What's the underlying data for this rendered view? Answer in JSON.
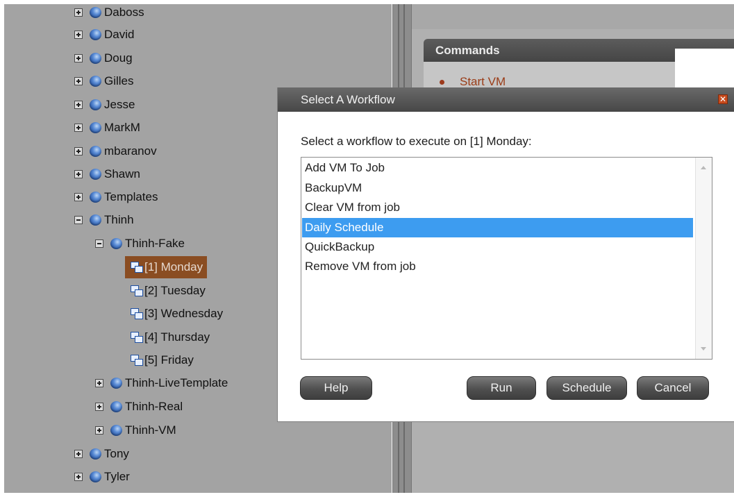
{
  "tree": {
    "nodes": [
      {
        "label": "Daboss",
        "expander": "plus"
      },
      {
        "label": "David",
        "expander": "plus"
      },
      {
        "label": "Doug",
        "expander": "plus"
      },
      {
        "label": "Gilles",
        "expander": "plus"
      },
      {
        "label": "Jesse",
        "expander": "plus"
      },
      {
        "label": "MarkM",
        "expander": "plus"
      },
      {
        "label": "mbaranov",
        "expander": "plus"
      },
      {
        "label": "Shawn",
        "expander": "plus"
      },
      {
        "label": "Templates",
        "expander": "plus"
      },
      {
        "label": "Thinh",
        "expander": "minus"
      },
      {
        "label": "Thinh-Fake",
        "expander": "minus"
      },
      {
        "label": "[1] Monday",
        "selected": true
      },
      {
        "label": "[2] Tuesday"
      },
      {
        "label": "[3] Wednesday"
      },
      {
        "label": "[4] Thursday"
      },
      {
        "label": "[5] Friday"
      },
      {
        "label": "Thinh-LiveTemplate",
        "expander": "plus"
      },
      {
        "label": "Thinh-Real",
        "expander": "plus"
      },
      {
        "label": "Thinh-VM",
        "expander": "plus"
      },
      {
        "label": "Tony",
        "expander": "plus"
      },
      {
        "label": "Tyler",
        "expander": "plus"
      }
    ]
  },
  "commands": {
    "header": "Commands",
    "items": [
      "Start VM"
    ]
  },
  "dialog": {
    "title": "Select A Workflow",
    "prompt": "Select a workflow to execute on [1] Monday:",
    "workflows": [
      "Add VM To Job",
      "BackupVM",
      "Clear VM from job",
      "Daily Schedule",
      "QuickBackup",
      "Remove VM from job"
    ],
    "selected_workflow": "Daily Schedule",
    "buttons": {
      "help": "Help",
      "run": "Run",
      "schedule": "Schedule",
      "cancel": "Cancel"
    },
    "close_glyph": "✕"
  },
  "colors": {
    "selection": "#3d9cf0",
    "tree_selection": "#8a4d22",
    "command_link": "#9a3c17"
  }
}
